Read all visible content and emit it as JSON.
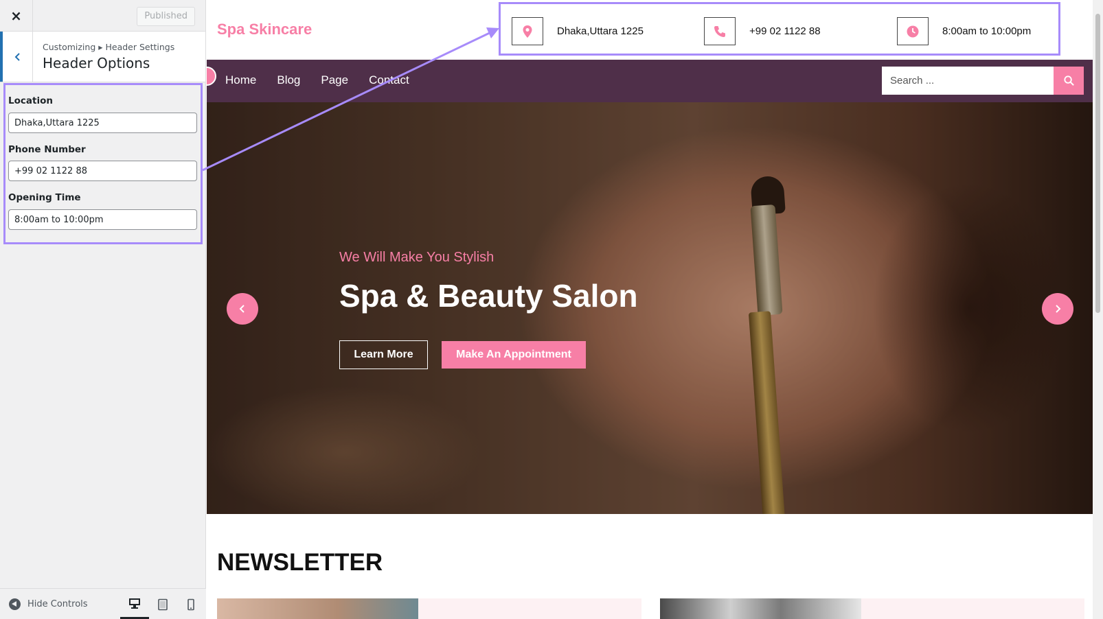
{
  "customizer": {
    "close_label": "×",
    "publish_label": "Published",
    "breadcrumb": "Customizing ▸ Header Settings",
    "section_title": "Header Options",
    "fields": [
      {
        "label": "Location",
        "value": "Dhaka,Uttara 1225"
      },
      {
        "label": "Phone Number",
        "value": "+99 02 1122 88"
      },
      {
        "label": "Opening Time",
        "value": "8:00am to 10:00pm"
      }
    ],
    "footer": {
      "hide_controls_label": "Hide Controls",
      "devices": [
        "desktop-icon",
        "tablet-icon",
        "mobile-icon"
      ],
      "active_device": "desktop"
    }
  },
  "site": {
    "brand": "Spa Skincare",
    "header_info": [
      {
        "icon": "location-pin-icon",
        "text": "Dhaka,Uttara 1225"
      },
      {
        "icon": "phone-icon",
        "text": "+99 02 1122 88"
      },
      {
        "icon": "clock-icon",
        "text": "8:00am to 10:00pm"
      }
    ],
    "nav": [
      "Home",
      "Blog",
      "Page",
      "Contact"
    ],
    "search": {
      "placeholder": "Search ..."
    },
    "hero": {
      "subtitle": "We Will Make You Stylish",
      "title": "Spa & Beauty Salon",
      "learn_more": "Learn More",
      "appointment": "Make An Appointment"
    },
    "newsletter_heading": "NEWSLETTER"
  },
  "colors": {
    "accent_pink": "#f77fa6",
    "nav_purple": "#4f2f49",
    "highlight_violet": "#a78bfa",
    "wp_blue": "#2271b1"
  }
}
